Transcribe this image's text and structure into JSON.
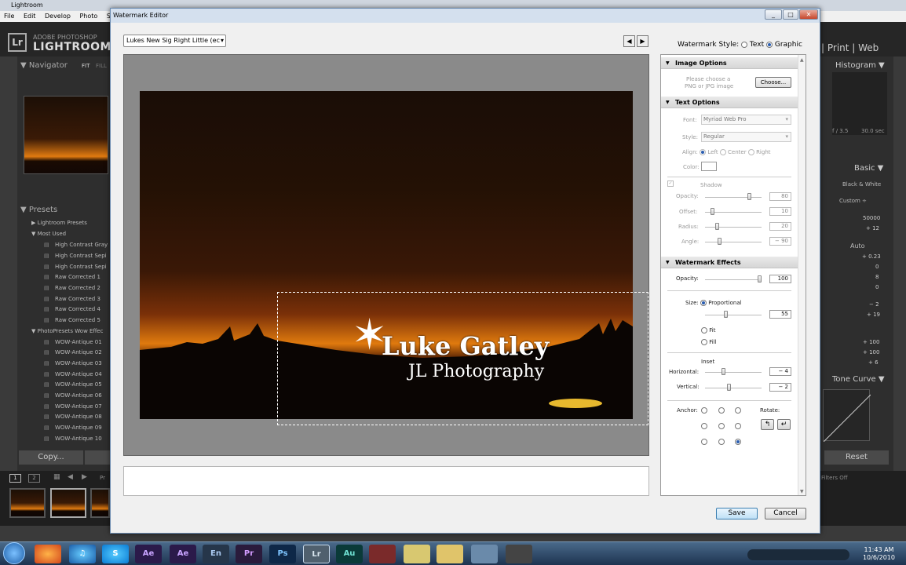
{
  "lightroom": {
    "title": "Lightroom",
    "menu": [
      "File",
      "Edit",
      "Develop",
      "Photo",
      "Setti"
    ],
    "logo_small": "ADOBE PHOTOSHOP",
    "logo_big": "LIGHTROOM",
    "logo_mark": "Lr",
    "modules": "| Print | Web",
    "navigator": "Navigator",
    "nav_fit": "FIT",
    "nav_fill": "FILL",
    "presets_title": "Presets",
    "preset_groups": [
      "Lightroom Presets",
      "Most Used",
      "PhotoPresets Wow Effec"
    ],
    "most_used": [
      "High Contrast Gray",
      "High Contrast Sepi",
      "High Contrast Sepi",
      "Raw Corrected 1",
      "Raw Corrected 2",
      "Raw Corrected 3",
      "Raw Corrected 4",
      "Raw Corrected 5"
    ],
    "wow": [
      "WOW-Antique 01",
      "WOW-Antique 02",
      "WOW-Antique 03",
      "WOW-Antique 04",
      "WOW-Antique 05",
      "WOW-Antique 06",
      "WOW-Antique 07",
      "WOW-Antique 08",
      "WOW-Antique 09",
      "WOW-Antique 10"
    ],
    "copy_button": "Copy...",
    "histogram": "Histogram",
    "basic": "Basic",
    "tone_curve": "Tone Curve",
    "reset_button": "Reset",
    "exif_aperture": "f / 3.5",
    "exif_shutter": "30.0 sec",
    "black_white": "Black & White",
    "wb_custom": "Custom ÷",
    "auto": "Auto",
    "right_values": [
      "50000",
      "+ 12",
      "+ 0.23",
      "0",
      "8",
      "0",
      "− 2",
      "+ 19",
      "+ 100",
      "+ 100",
      "+ 6"
    ],
    "filters_off": "Filters Off",
    "filmstrip_pages": [
      "1",
      "2"
    ],
    "pr_label": "Pr"
  },
  "taskbar": {
    "apps": [
      "Ae",
      "Ae",
      "En",
      "Pr",
      "Ps",
      "Lr",
      "Au"
    ],
    "time": "11:43 AM",
    "date": "10/6/2010"
  },
  "dialog": {
    "title": "Watermark Editor",
    "preset_value": "Lukes New Sig Right Little (ec",
    "prev_label": "◀",
    "next_label": "▶",
    "watermark_style_label": "Watermark Style:",
    "style_text": "Text",
    "style_graphic": "Graphic",
    "watermark_line1": "Luke Gatley",
    "watermark_line2": "JL Photography",
    "save": "Save",
    "cancel": "Cancel"
  },
  "panel": {
    "image_options": "Image Options",
    "choose_hint_1": "Please choose a",
    "choose_hint_2": "PNG or JPG image",
    "choose_button": "Choose...",
    "text_options": "Text Options",
    "font_label": "Font:",
    "font_value": "Myriad Web Pro",
    "style_label": "Style:",
    "style_value": "Regular",
    "align_label": "Align:",
    "align_left": "Left",
    "align_center": "Center",
    "align_right": "Right",
    "color_label": "Color:",
    "shadow_label": "Shadow",
    "shadow_opacity_label": "Opacity:",
    "shadow_opacity": "80",
    "shadow_offset_label": "Offset:",
    "shadow_offset": "10",
    "shadow_radius_label": "Radius:",
    "shadow_radius": "20",
    "shadow_angle_label": "Angle:",
    "shadow_angle": "− 90",
    "watermark_effects": "Watermark Effects",
    "opacity_label": "Opacity:",
    "opacity_value": "100",
    "size_label": "Size:",
    "size_proportional": "Proportional",
    "size_value": "55",
    "size_fit": "Fit",
    "size_fill": "Fill",
    "inset_label": "Inset",
    "horizontal_label": "Horizontal:",
    "horizontal_value": "− 4",
    "vertical_label": "Vertical:",
    "vertical_value": "− 2",
    "anchor_label": "Anchor:",
    "rotate_label": "Rotate:"
  }
}
